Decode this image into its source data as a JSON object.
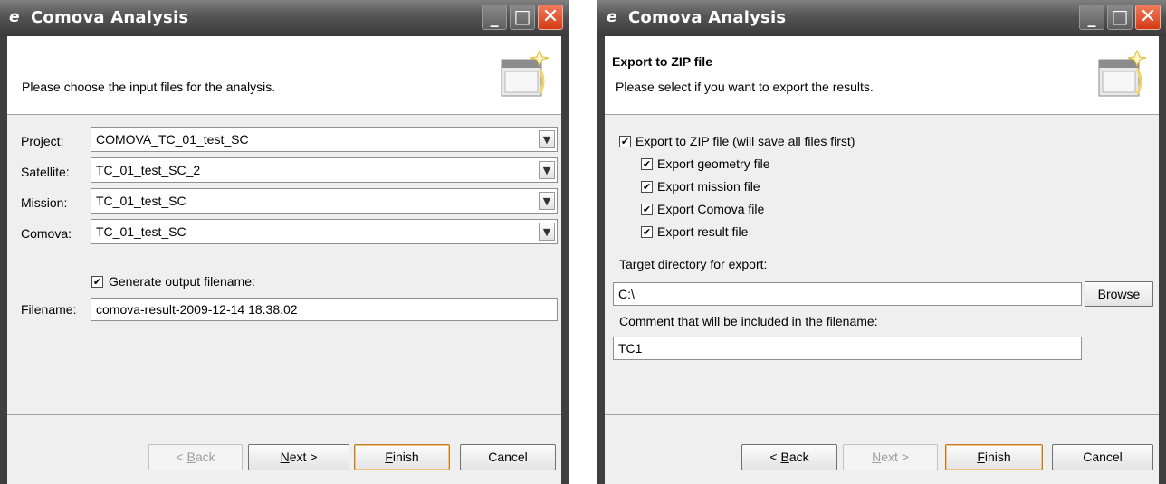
{
  "windows": [
    {
      "title": "Comova Analysis",
      "header_title": "",
      "header_desc": "Please choose the input files for the analysis.",
      "fields": [
        {
          "label": "Project:",
          "value": "COMOVA_TC_01_test_SC"
        },
        {
          "label": "Satellite:",
          "value": "TC_01_test_SC_2"
        },
        {
          "label": "Mission:",
          "value": "TC_01_test_SC"
        },
        {
          "label": "Comova:",
          "value": "TC_01_test_SC"
        }
      ],
      "generate_checkbox": {
        "label": "Generate output filename:",
        "checked": true
      },
      "filename": {
        "label": "Filename:",
        "value": "comova-result-2009-12-14 18.38.02"
      },
      "buttons": {
        "back": {
          "prefix": "< ",
          "mnemonic": "B",
          "rest": "ack",
          "enabled": false
        },
        "next": {
          "prefix": "",
          "mnemonic": "N",
          "rest": "ext >",
          "enabled": true
        },
        "finish": {
          "mnemonic": "F",
          "rest": "inish",
          "enabled": true
        },
        "cancel": {
          "label": "Cancel",
          "enabled": true
        }
      }
    },
    {
      "title": "Comova Analysis",
      "header_title": "Export to ZIP file",
      "header_desc": "Please select if you want to export the results.",
      "export_zip": {
        "label": "Export to ZIP file (will save all files first)",
        "checked": true
      },
      "export_options": [
        {
          "label": "Export geometry file",
          "checked": true
        },
        {
          "label": "Export mission file",
          "checked": true
        },
        {
          "label": "Export Comova file",
          "checked": true
        },
        {
          "label": "Export result file",
          "checked": true
        }
      ],
      "target_dir": {
        "label": "Target directory for export:",
        "value": "C:\\",
        "browse_label": "Browse"
      },
      "comment": {
        "label": "Comment that will be included in the filename:",
        "value": "TC1"
      },
      "buttons": {
        "back": {
          "prefix": "< ",
          "mnemonic": "B",
          "rest": "ack",
          "enabled": true
        },
        "next": {
          "prefix": "",
          "mnemonic": "N",
          "rest": "ext >",
          "enabled": false
        },
        "finish": {
          "mnemonic": "F",
          "rest": "inish",
          "enabled": true
        },
        "cancel": {
          "label": "Cancel",
          "enabled": true
        }
      }
    }
  ],
  "check_glyph": "✔",
  "icons": {
    "app": "app-icon",
    "minimize": "minimize-icon",
    "maximize": "maximize-icon",
    "close": "close-icon",
    "dropdown": "chevron-down-icon",
    "wizard": "wizard-banner-icon"
  }
}
